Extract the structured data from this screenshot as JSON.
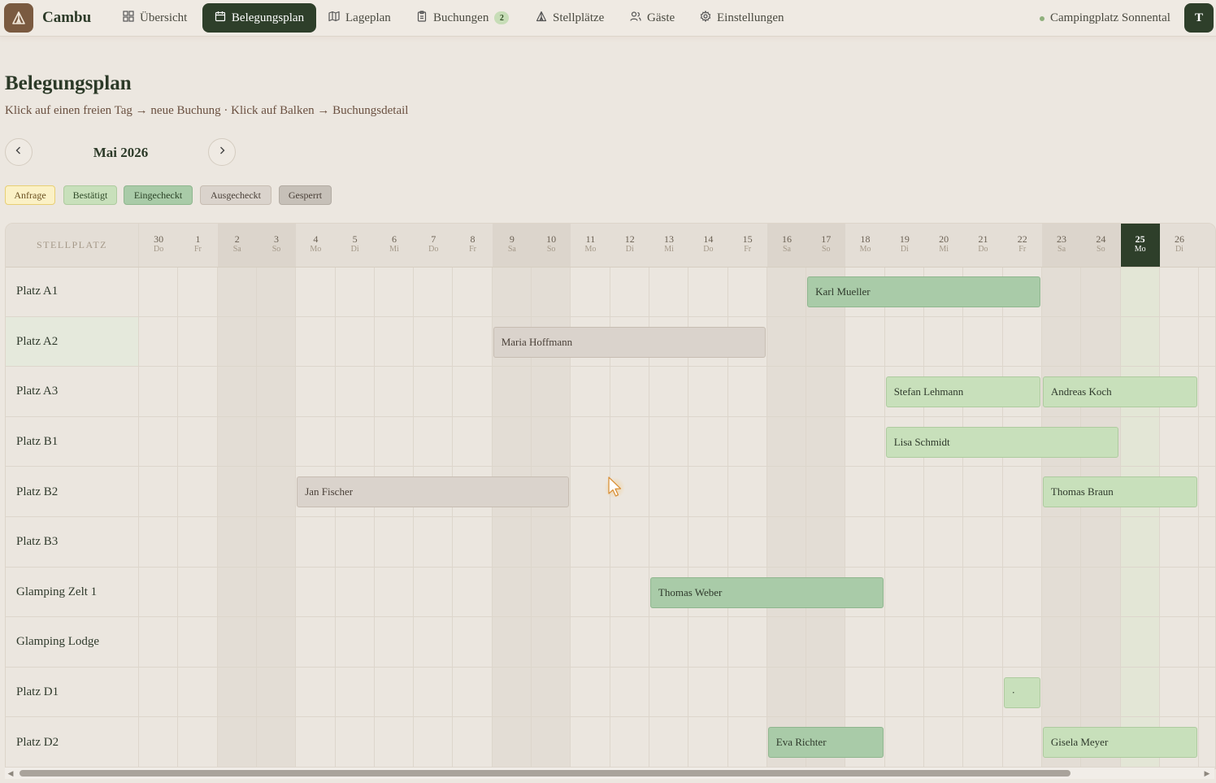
{
  "app": {
    "brand": "Cambu",
    "site": "Campingplatz Sonnental",
    "user_initial": "T"
  },
  "nav": [
    {
      "label": "Übersicht",
      "icon": "grid-icon"
    },
    {
      "label": "Belegungsplan",
      "icon": "calendar-icon",
      "active": true
    },
    {
      "label": "Lageplan",
      "icon": "map-icon"
    },
    {
      "label": "Buchungen",
      "icon": "clipboard-icon",
      "badge": "2"
    },
    {
      "label": "Stellplätze",
      "icon": "tent-icon"
    },
    {
      "label": "Gäste",
      "icon": "users-icon"
    },
    {
      "label": "Einstellungen",
      "icon": "gear-icon"
    }
  ],
  "page": {
    "title": "Belegungsplan",
    "subtitle": "Klick auf einen freien Tag → neue Buchung · Klick auf Balken → Buchungsdetail",
    "month": "Mai 2026"
  },
  "legend": [
    {
      "label": "Anfrage",
      "bg": "#fbf1c6",
      "border": "#e8cf74",
      "color": "#6a5020"
    },
    {
      "label": "Bestätigt",
      "bg": "#c8e0bb",
      "border": "#aecb9f",
      "color": "#2f4a28"
    },
    {
      "label": "Eingecheckt",
      "bg": "#a9cba8",
      "border": "#8fb68e",
      "color": "#2a4226"
    },
    {
      "label": "Ausgecheckt",
      "bg": "#dad3cc",
      "border": "#c7bdb2",
      "color": "#4a4038"
    },
    {
      "label": "Gesperrt",
      "bg": "#c6c0b8",
      "border": "#b2aba2",
      "color": "#4a4038"
    }
  ],
  "grid": {
    "header_label": "STELLPLATZ",
    "days": [
      {
        "num": "30",
        "wd": "Do"
      },
      {
        "num": "1",
        "wd": "Fr"
      },
      {
        "num": "2",
        "wd": "Sa",
        "weekend": true
      },
      {
        "num": "3",
        "wd": "So",
        "weekend": true
      },
      {
        "num": "4",
        "wd": "Mo"
      },
      {
        "num": "5",
        "wd": "Di"
      },
      {
        "num": "6",
        "wd": "Mi"
      },
      {
        "num": "7",
        "wd": "Do"
      },
      {
        "num": "8",
        "wd": "Fr"
      },
      {
        "num": "9",
        "wd": "Sa",
        "weekend": true
      },
      {
        "num": "10",
        "wd": "So",
        "weekend": true
      },
      {
        "num": "11",
        "wd": "Mo"
      },
      {
        "num": "12",
        "wd": "Di"
      },
      {
        "num": "13",
        "wd": "Mi"
      },
      {
        "num": "14",
        "wd": "Do"
      },
      {
        "num": "15",
        "wd": "Fr"
      },
      {
        "num": "16",
        "wd": "Sa",
        "weekend": true
      },
      {
        "num": "17",
        "wd": "So",
        "weekend": true
      },
      {
        "num": "18",
        "wd": "Mo"
      },
      {
        "num": "19",
        "wd": "Di"
      },
      {
        "num": "20",
        "wd": "Mi"
      },
      {
        "num": "21",
        "wd": "Do"
      },
      {
        "num": "22",
        "wd": "Fr"
      },
      {
        "num": "23",
        "wd": "Sa",
        "weekend": true
      },
      {
        "num": "24",
        "wd": "So",
        "weekend": true
      },
      {
        "num": "25",
        "wd": "Mo",
        "today": true
      },
      {
        "num": "26",
        "wd": "Di"
      }
    ],
    "rows": [
      {
        "name": "Platz A1"
      },
      {
        "name": "Platz A2",
        "highlight": true
      },
      {
        "name": "Platz A3"
      },
      {
        "name": "Platz B1"
      },
      {
        "name": "Platz B2"
      },
      {
        "name": "Platz B3"
      },
      {
        "name": "Glamping Zelt 1"
      },
      {
        "name": "Glamping Lodge"
      },
      {
        "name": "Platz D1"
      },
      {
        "name": "Platz D2"
      }
    ],
    "bookings": [
      {
        "row": 0,
        "start": 17,
        "end": 22,
        "guest": "Karl Mueller",
        "status": "eingecheckt"
      },
      {
        "row": 1,
        "start": 9,
        "end": 15,
        "guest": "Maria Hoffmann",
        "status": "ausgecheckt"
      },
      {
        "row": 2,
        "start": 19,
        "end": 22,
        "guest": "Stefan Lehmann",
        "status": "bestaetigt"
      },
      {
        "row": 2,
        "start": 23,
        "end": 26,
        "guest": "Andreas Koch",
        "status": "bestaetigt"
      },
      {
        "row": 3,
        "start": 19,
        "end": 24,
        "guest": "Lisa Schmidt",
        "status": "bestaetigt"
      },
      {
        "row": 4,
        "start": 4,
        "end": 10,
        "guest": "Jan Fischer",
        "status": "ausgecheckt"
      },
      {
        "row": 4,
        "start": 23,
        "end": 26,
        "guest": "Thomas Braun",
        "status": "bestaetigt"
      },
      {
        "row": 6,
        "start": 13,
        "end": 18,
        "guest": "Thomas Weber",
        "status": "eingecheckt"
      },
      {
        "row": 8,
        "start": 22,
        "end": 22,
        "guest": "·",
        "status": "bestaetigt"
      },
      {
        "row": 9,
        "start": 16,
        "end": 18,
        "guest": "Eva Richter",
        "status": "eingecheckt"
      },
      {
        "row": 9,
        "start": 23,
        "end": 26,
        "guest": "Gisela Meyer",
        "status": "bestaetigt"
      }
    ]
  }
}
